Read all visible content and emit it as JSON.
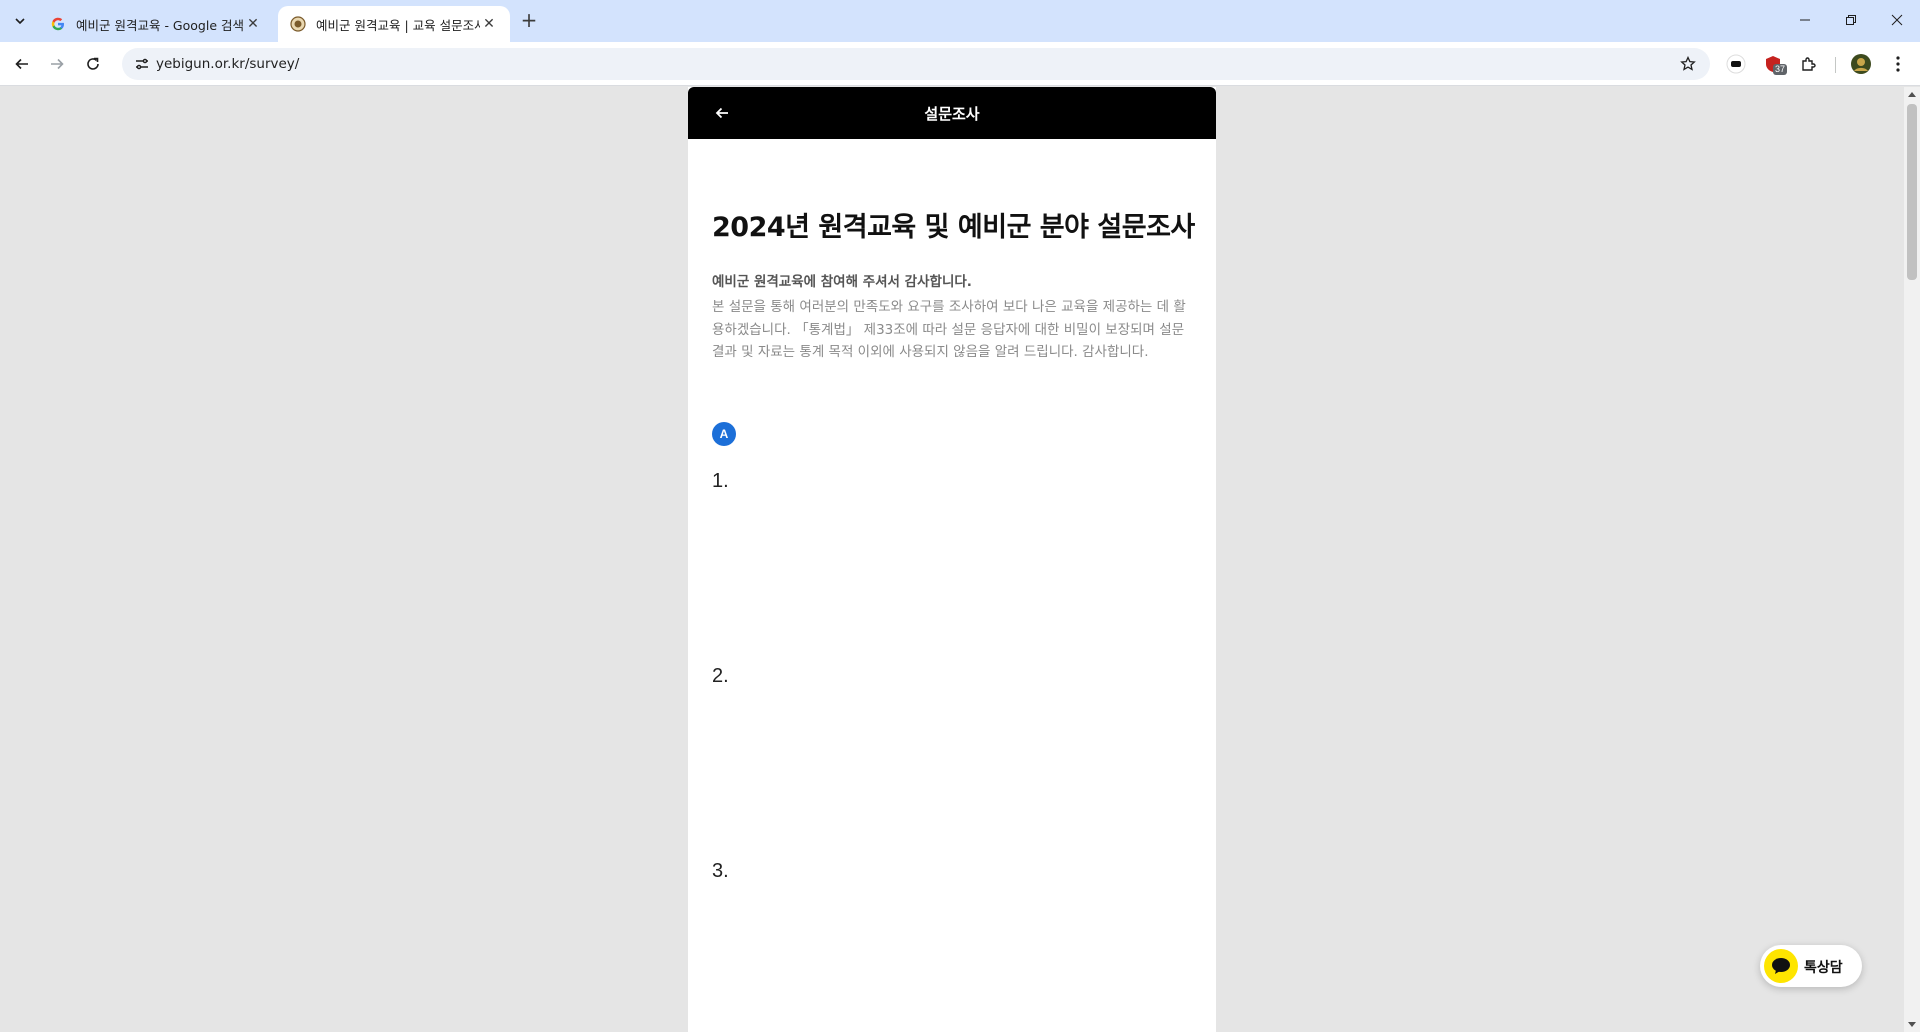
{
  "browser": {
    "tabs": [
      {
        "title": "예비군 원격교육 - Google 검색",
        "active": false,
        "favicon": "google-icon"
      },
      {
        "title": "예비군 원격교육 | 교육 설문조사",
        "active": true,
        "favicon": "emblem-icon"
      }
    ],
    "url": "yebigun.or.kr/survey/",
    "extension_badge": "37"
  },
  "page": {
    "header_title": "설문조사",
    "survey_title": "2024년 원격교육 및 예비군 분야 설문조사",
    "intro_bold": "예비군 원격교육에 참여해 주셔서 감사합니다.",
    "intro_text": "본 설문을 통해 여러분의 만족도와 요구를 조사하여 보다 나은 교육을 제공하는 데 활용하겠습니다. 「통계법」 제33조에 따라 설문 응답자에 대한 비밀이 보장되며 설문 결과 및 자료는 통계 목적 이외에 사용되지 않음을 알려 드립니다. 감사합니다.",
    "section_label": "A",
    "questions": [
      {
        "number": "1."
      },
      {
        "number": "2."
      },
      {
        "number": "3."
      }
    ]
  },
  "chat_button": {
    "label": "톡상담"
  },
  "colors": {
    "tabbar": "#d3e3fd",
    "page_background": "#e5e5e5",
    "header": "#000000",
    "section_badge": "#1c6fd8",
    "chat_bubble": "#fee500"
  }
}
